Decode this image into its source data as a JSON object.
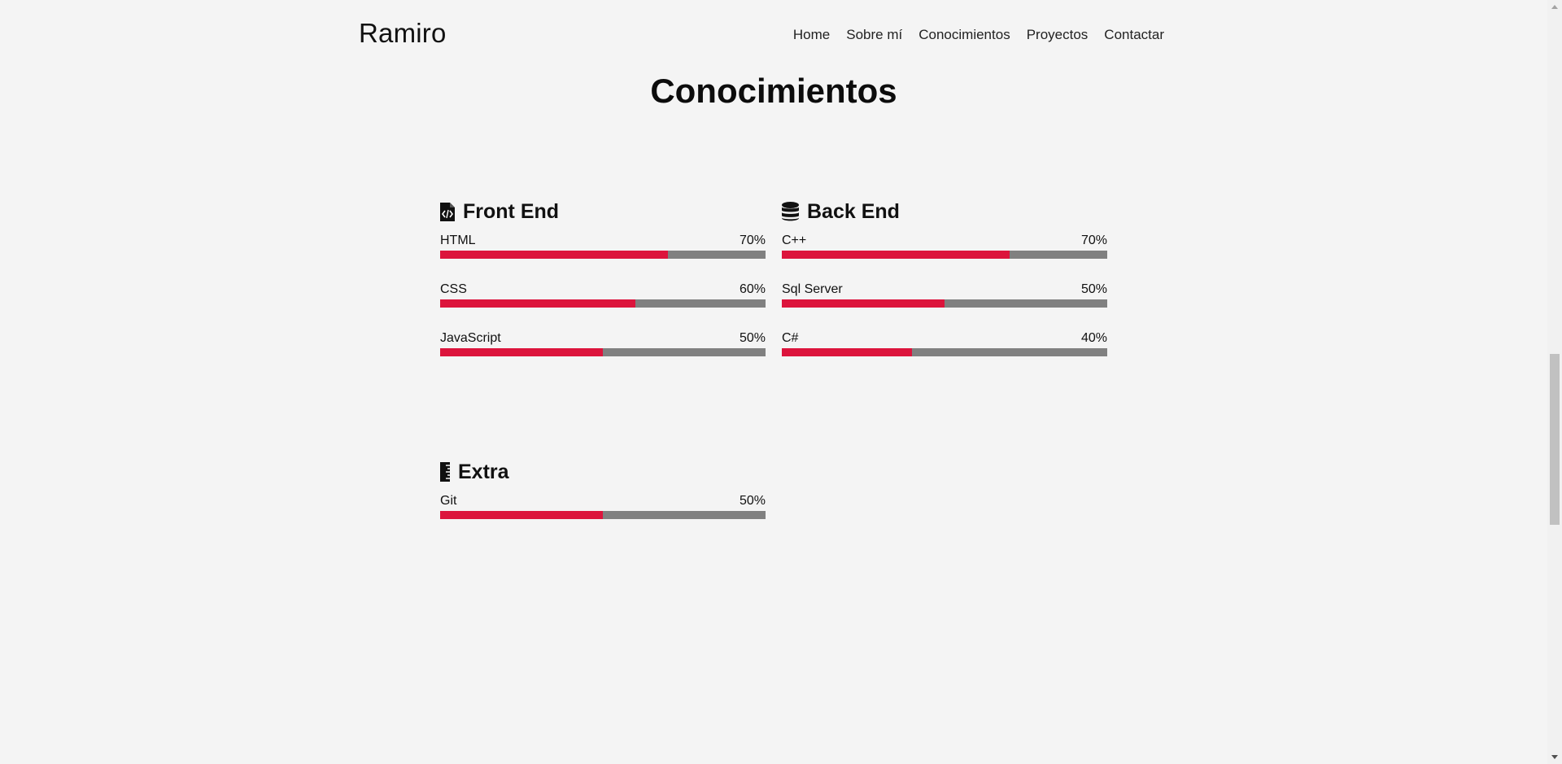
{
  "header": {
    "logo": "Ramiro",
    "nav": [
      "Home",
      "Sobre mí",
      "Conocimientos",
      "Proyectos",
      "Contactar"
    ]
  },
  "section": {
    "title": "Conocimientos"
  },
  "groups": [
    {
      "title": "Front End",
      "icon": "file-code-icon",
      "skills": [
        {
          "name": "HTML",
          "percent": "70%",
          "level": 0.7
        },
        {
          "name": "CSS",
          "percent": "60%",
          "level": 0.6
        },
        {
          "name": "JavaScript",
          "percent": "50%",
          "level": 0.5
        }
      ]
    },
    {
      "title": "Back End",
      "icon": "database-icon",
      "skills": [
        {
          "name": "C++",
          "percent": "70%",
          "level": 0.7
        },
        {
          "name": "Sql Server",
          "percent": "50%",
          "level": 0.5
        },
        {
          "name": "C#",
          "percent": "40%",
          "level": 0.4
        }
      ]
    },
    {
      "title": "Extra",
      "icon": "ruler-icon",
      "skills": [
        {
          "name": "Git",
          "percent": "50%",
          "level": 0.5
        }
      ]
    }
  ],
  "colors": {
    "accent": "#dc143c",
    "track": "#808080",
    "background": "#f4f4f4"
  }
}
